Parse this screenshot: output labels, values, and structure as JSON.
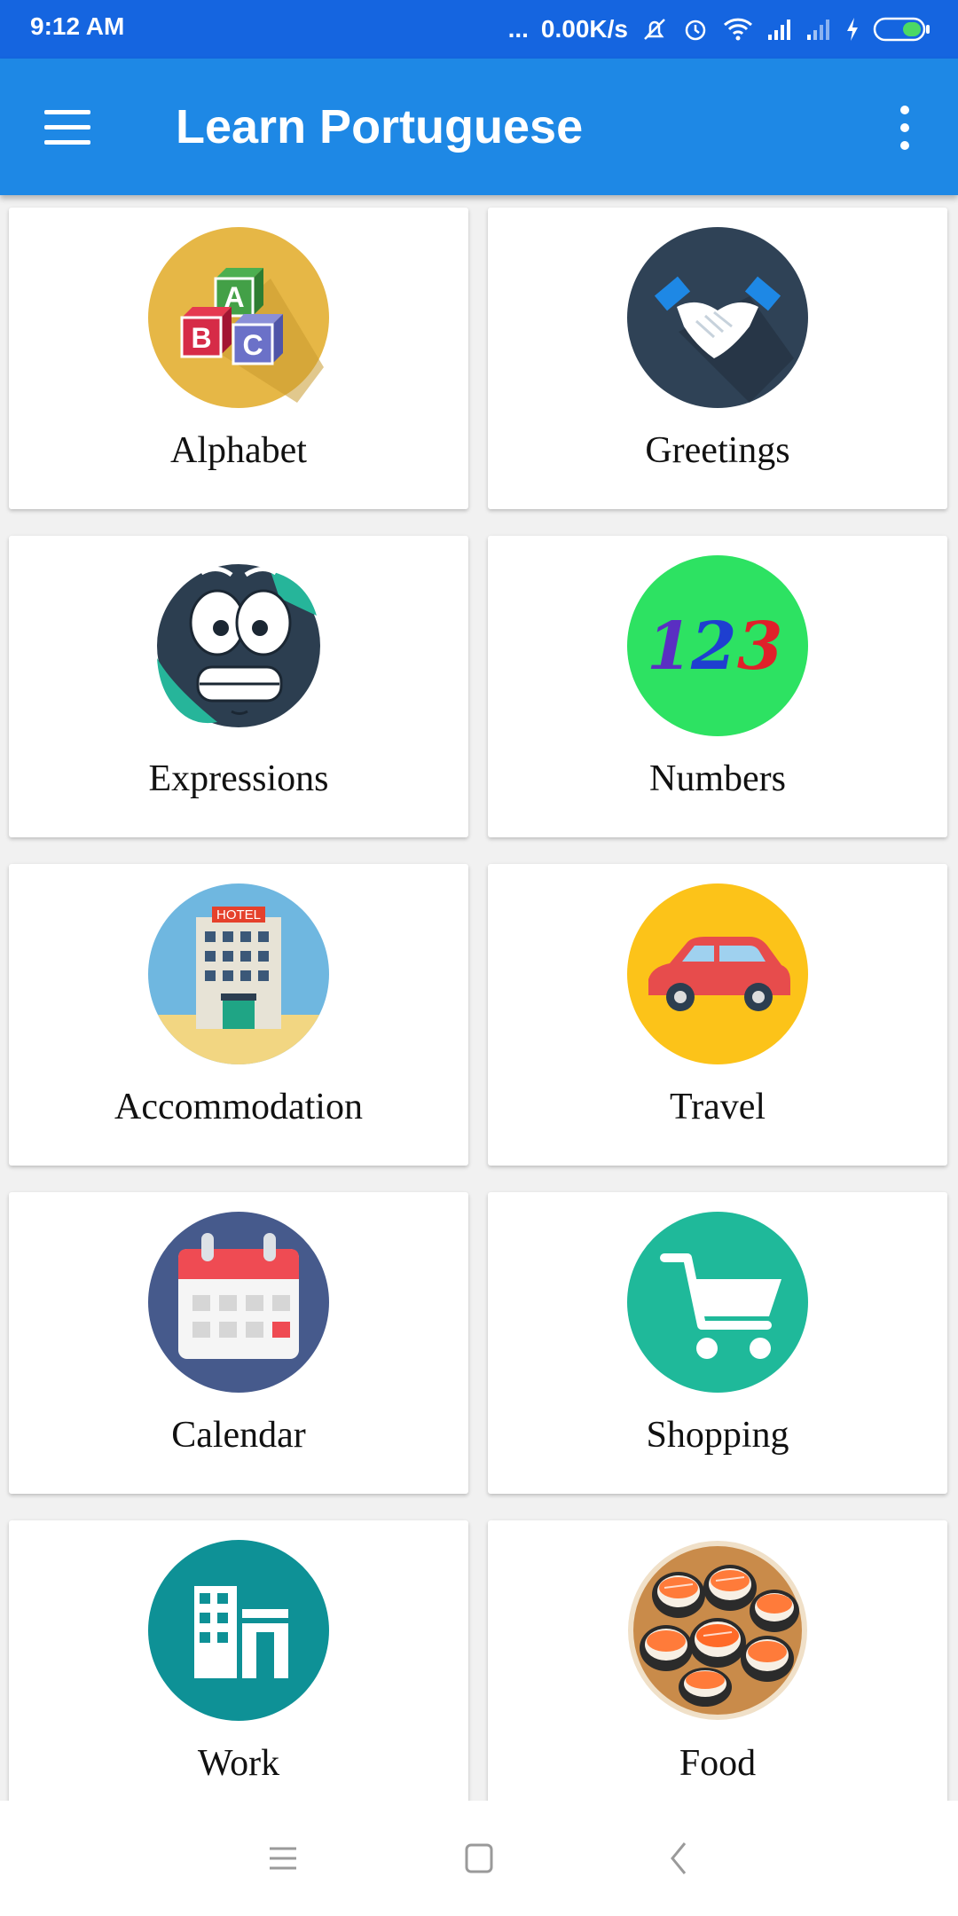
{
  "status_bar": {
    "time": "9:12 AM",
    "dots": "...",
    "net_speed": "0.00K/s",
    "icons": [
      "mute-icon",
      "alarm-icon",
      "wifi-icon",
      "signal-icon",
      "signal-icon",
      "charging-icon",
      "battery-icon"
    ]
  },
  "app_bar": {
    "title": "Learn Portuguese",
    "color": "#1e88e5",
    "status_color": "#1565e0"
  },
  "categories": [
    {
      "label": "Alphabet",
      "icon": "abc-blocks-icon"
    },
    {
      "label": "Greetings",
      "icon": "handshake-icon"
    },
    {
      "label": "Expressions",
      "icon": "face-globe-icon"
    },
    {
      "label": "Numbers",
      "icon": "numbers-123-icon"
    },
    {
      "label": "Accommodation",
      "icon": "hotel-icon",
      "icon_text": "HOTEL"
    },
    {
      "label": "Travel",
      "icon": "car-icon"
    },
    {
      "label": "Calendar",
      "icon": "calendar-icon"
    },
    {
      "label": "Shopping",
      "icon": "shopping-cart-icon"
    },
    {
      "label": "Work",
      "icon": "office-building-icon"
    },
    {
      "label": "Food",
      "icon": "sushi-icon"
    }
  ],
  "numbers_icon_text": "123",
  "nav_bar": {
    "icons": [
      "recent-apps-icon",
      "home-icon",
      "back-icon"
    ]
  }
}
